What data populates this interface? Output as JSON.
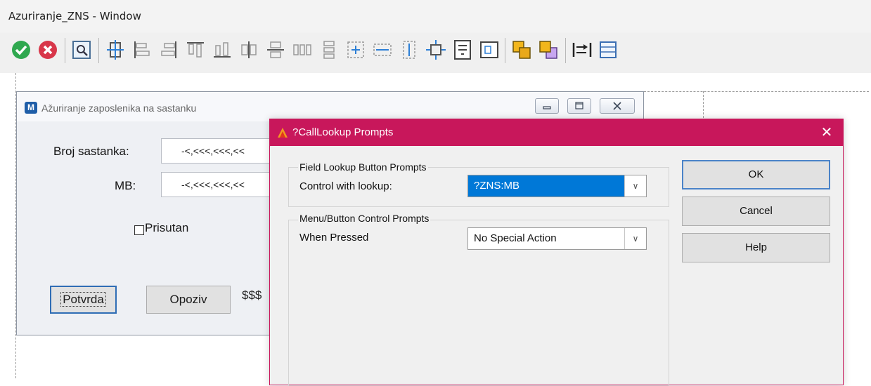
{
  "designer": {
    "title": "Azuriranje_ZNS - Window"
  },
  "toolbar": {
    "icons": [
      "ok-icon",
      "cancel-icon",
      "preview-icon",
      "align-center-icon",
      "align-left-icon",
      "align-right-icon",
      "align-top-icon",
      "align-bottom-icon",
      "center-horizontal-icon",
      "center-vertical-icon",
      "spread-horizontal-icon",
      "spread-vertical-icon",
      "make-same-size-icon",
      "make-same-width-icon",
      "make-same-height-icon",
      "center-in-window-icon",
      "tab-order-icon",
      "dimensions-icon",
      "bring-to-front-icon",
      "send-to-back-icon",
      "tab-order-arrow-icon",
      "grid-icon"
    ]
  },
  "form": {
    "title": "Ažuriranje zaposlenika na sastanku",
    "icon_letter": "M",
    "broj_sastanka_label": "Broj sastanka:",
    "broj_sastanka_value": "-<,<<<,<<<,<<",
    "mb_label": "MB:",
    "mb_value": "-<,<<<,<<<,<<",
    "prisutan_label": "Prisutan",
    "potvrda_label": "Potvrda",
    "opoziv_label": "Opoziv",
    "dollar_text": "$$$"
  },
  "dialog": {
    "title": "?CallLookup Prompts",
    "close_glyph": "✕",
    "group1_title": "Field Lookup Button Prompts",
    "control_with_lookup_label": "Control with lookup:",
    "control_with_lookup_value": "?ZNS:MB",
    "group2_title": "Menu/Button Control Prompts",
    "when_pressed_label": "When Pressed",
    "when_pressed_value": "No Special Action",
    "combo_arrow": "∨",
    "ok_label": "OK",
    "cancel_label": "Cancel",
    "help_label": "Help"
  },
  "colors": {
    "dialog_accent": "#c8175b",
    "selection": "#0078d7",
    "form_background": "#eef0f4"
  }
}
